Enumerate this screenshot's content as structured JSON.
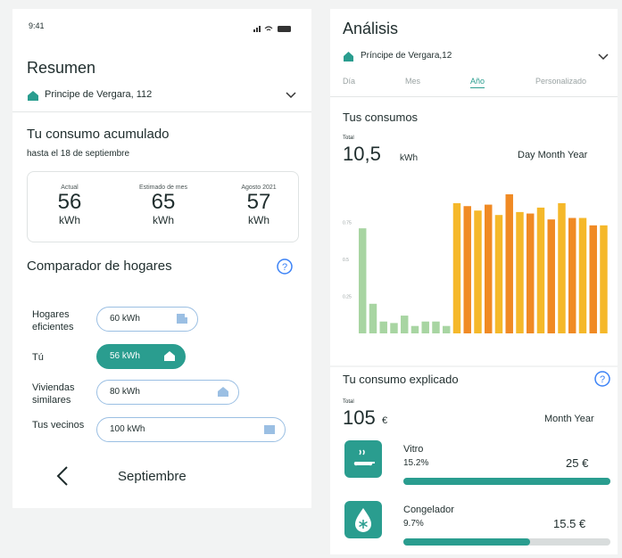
{
  "left": {
    "status_time": "9:41",
    "title": "Resumen",
    "address": "Principe de Vergara, 112",
    "consumo_title": "Tu consumo acumulado",
    "consumo_sub": "hasta el 18 de septiembre",
    "stats": [
      {
        "label": "Actual",
        "value": "56",
        "unit": "kWh"
      },
      {
        "label": "Estimado de mes",
        "value": "65",
        "unit": "kWh"
      },
      {
        "label": "Agosto 2021",
        "value": "57",
        "unit": "kWh"
      }
    ],
    "comparador_title": "Comparador de hogares",
    "comparador_rows": [
      {
        "label": "Hogares eficientes",
        "value": "60 kWh",
        "kwh": 60
      },
      {
        "label": "Tú",
        "value": "56 kWh",
        "kwh": 56
      },
      {
        "label": "Viviendas similares",
        "value": "80 kWh",
        "kwh": 80
      },
      {
        "label": "Tus vecinos",
        "value": "100 kWh",
        "kwh": 100
      }
    ],
    "month": "Septiembre"
  },
  "right": {
    "title": "Análisis",
    "address": "Príncipe de Vergara,12",
    "tabs": [
      {
        "label": "Día",
        "active": false
      },
      {
        "label": "Mes",
        "active": false
      },
      {
        "label": "Año",
        "active": true
      },
      {
        "label": "Personalizado",
        "active": false
      }
    ],
    "consumos_title": "Tus consumos",
    "total_label": "Total",
    "total_value": "10,5",
    "total_unit": "kWh",
    "range_options": "Day Month Year",
    "explicado_title": "Tu consumo explicado",
    "explicado_total_label": "Total",
    "explicado_total_value": "105",
    "explicado_total_unit": "€",
    "explicado_range": "Month Year",
    "categories": [
      {
        "name": "Vitro",
        "percent_label": "15.2%",
        "amount": "25 €",
        "progress": 1.0,
        "icon": "cooktop-icon"
      },
      {
        "name": "Congelador",
        "percent_label": "9.7%",
        "amount": "15.5 €",
        "progress": 0.61,
        "icon": "snowflake-drop-icon"
      }
    ]
  },
  "chart_data": {
    "type": "bar",
    "ylim": [
      0,
      1
    ],
    "y_ticks": [
      "0.75",
      "0.5",
      "0.25"
    ],
    "series": [
      {
        "color": "#a8d5a2",
        "values": [
          0.71,
          0.2,
          0.08,
          0.07,
          0.12,
          0.05,
          0.08,
          0.08,
          0.05
        ]
      },
      {
        "color_primary": "#f5b82a",
        "color_alt": "#f08a24",
        "values": [
          0.88,
          0.86,
          0.83,
          0.87,
          0.8,
          0.94,
          0.82,
          0.81,
          0.85,
          0.77,
          0.88,
          0.78,
          0.78,
          0.73,
          0.73
        ]
      }
    ]
  }
}
